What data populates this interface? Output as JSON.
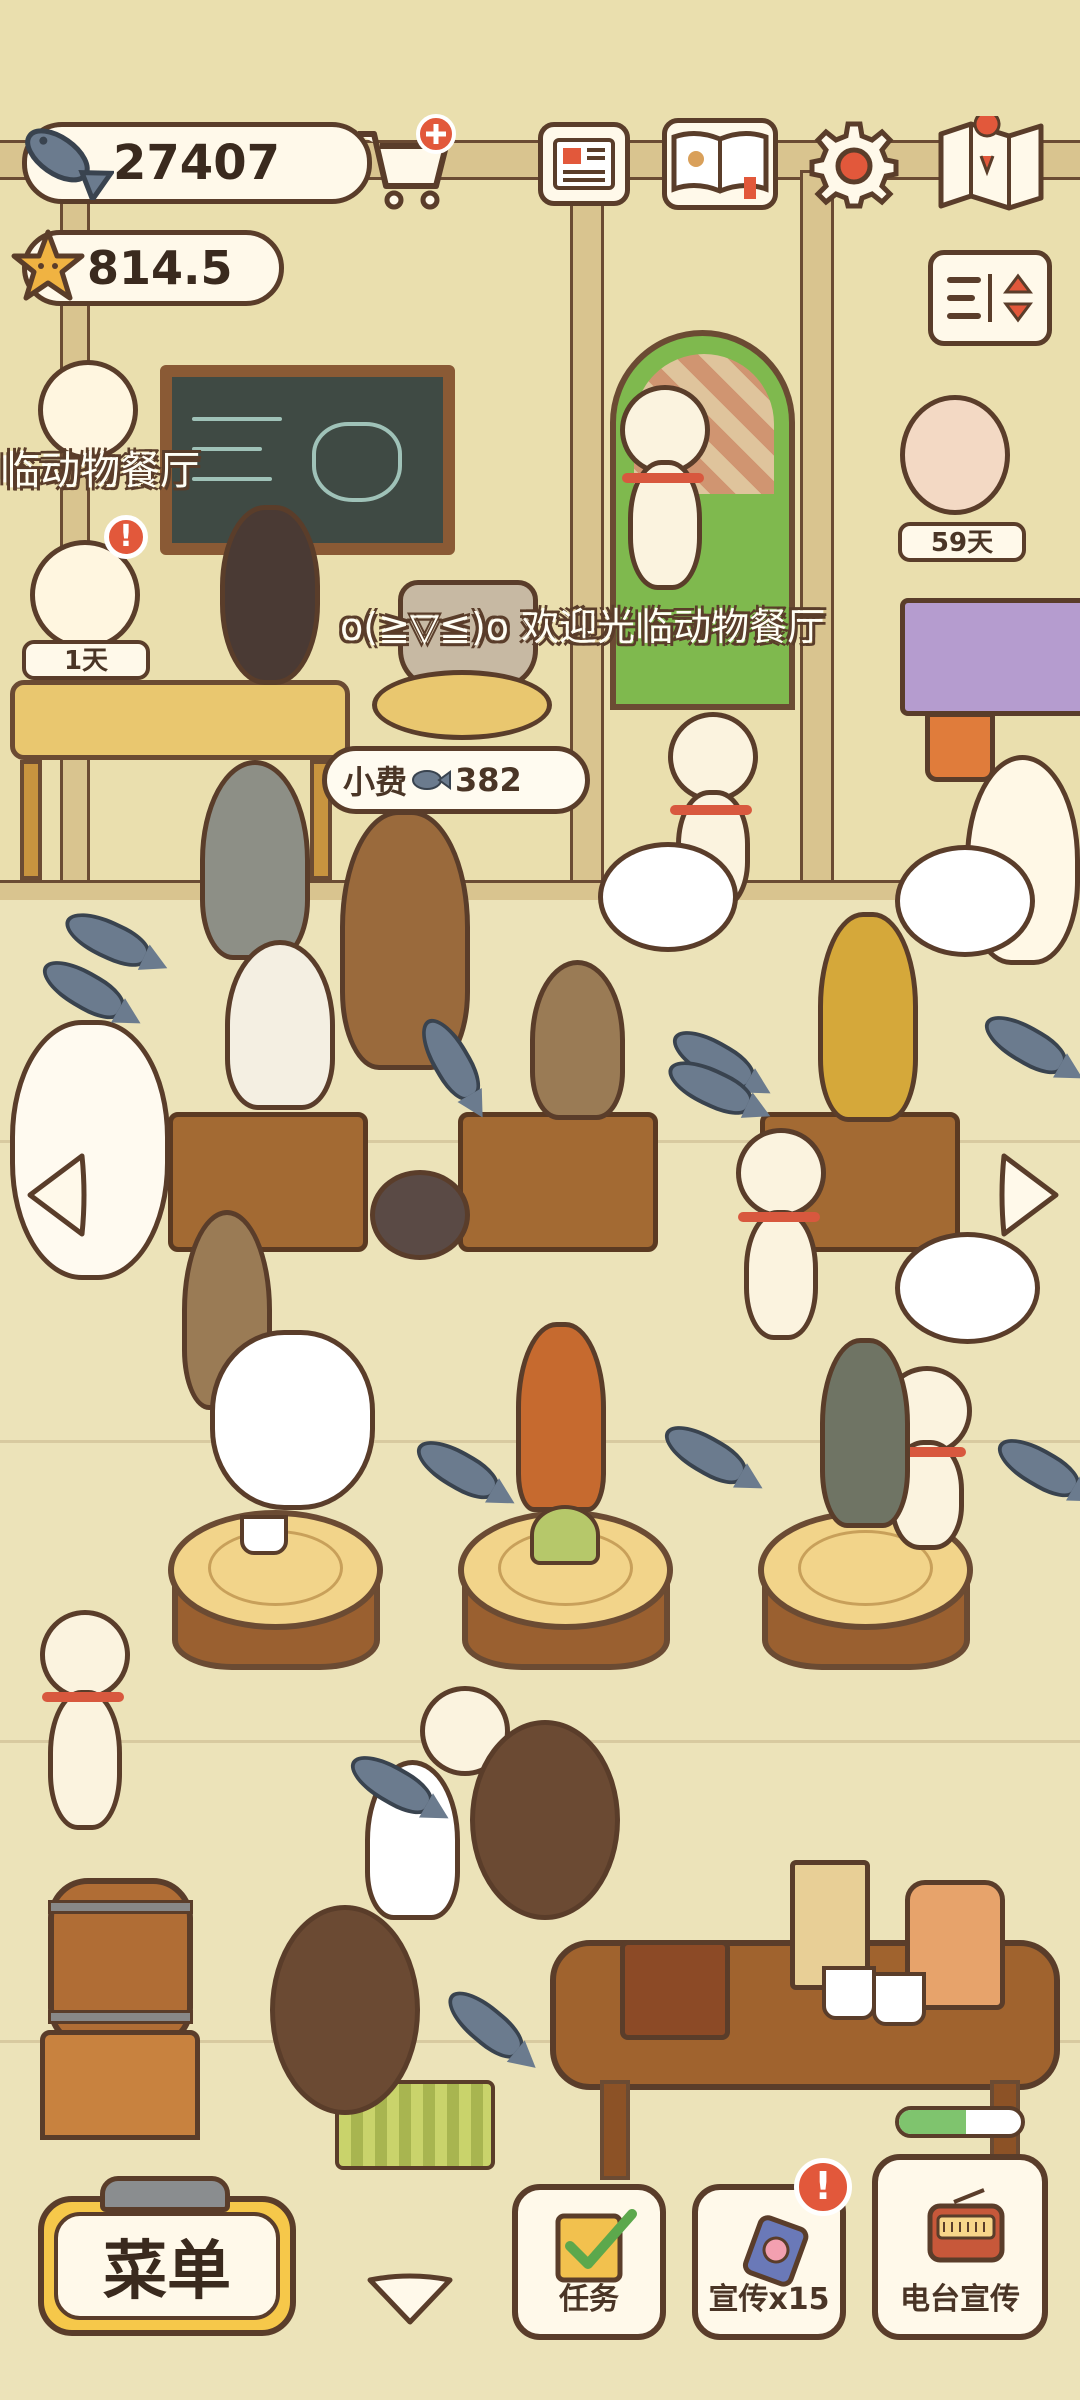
{
  "hud": {
    "fish_currency": "27407",
    "star_rating": "814.5"
  },
  "restaurant": {
    "name_banner": "临动物餐厅",
    "welcome_message": "o(≧▽≦)o 欢迎光临动物餐厅",
    "tip_label": "小费",
    "tip_amount": "382"
  },
  "badges": {
    "cat_chef_days": "1天",
    "visitor_days": "59天"
  },
  "bottom_bar": {
    "menu_label": "菜单",
    "tasks_label": "任务",
    "promote_label": "宣传x15",
    "radio_label": "电台宣传"
  },
  "alerts": {
    "promote_alert": "!",
    "cat_chef_alert": "!"
  },
  "colors": {
    "accent_yellow": "#f6c84a",
    "alert_red": "#e2583b",
    "outline_brown": "#5a3d2a"
  },
  "icons": [
    "fish-icon",
    "cart-plus-icon",
    "newspaper-icon",
    "recipe-book-icon",
    "settings-gear-icon",
    "map-icon",
    "star-icon",
    "sort-icon",
    "checklist-icon",
    "promo-card-icon",
    "radio-icon",
    "chevron-down-icon",
    "arrow-left-icon",
    "arrow-right-icon"
  ]
}
